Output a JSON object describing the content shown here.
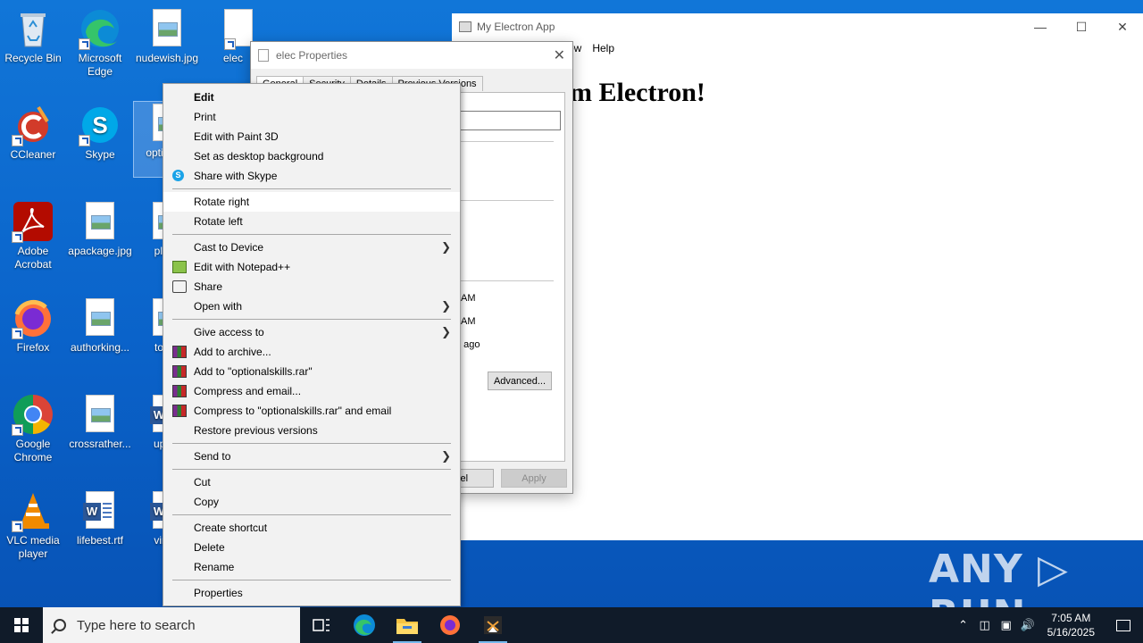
{
  "desktop": {
    "icons": [
      {
        "label": "Recycle Bin"
      },
      {
        "label": "Microsoft Edge"
      },
      {
        "label": "nudewish.jpg"
      },
      {
        "label": "elec"
      },
      {
        "label": "CCleaner"
      },
      {
        "label": "Skype"
      },
      {
        "label": "optio… .j"
      },
      {
        "label": "Adobe Acrobat"
      },
      {
        "label": "apackage.jpg"
      },
      {
        "label": "plans"
      },
      {
        "label": "Firefox"
      },
      {
        "label": "authorking..."
      },
      {
        "label": "toolki"
      },
      {
        "label": "Google Chrome"
      },
      {
        "label": "crossrather..."
      },
      {
        "label": "updat"
      },
      {
        "label": "VLC media player"
      },
      {
        "label": "lifebest.rtf"
      },
      {
        "label": "virtua"
      }
    ]
  },
  "electron": {
    "title": "My Electron App",
    "menu": [
      "ow",
      "Help"
    ],
    "heading": "m Electron!",
    "minimize": "—",
    "maximize": "☐",
    "close": "✕"
  },
  "properties": {
    "title": "elec Properties",
    "close": "✕",
    "tabs": [
      "General",
      "Security",
      "Details",
      "Previous Versions"
    ],
    "times": [
      "AM",
      "AM",
      "e ago"
    ],
    "advanced": "Advanced...",
    "cancel": "ncel",
    "apply": "Apply"
  },
  "context_menu": {
    "items": [
      {
        "label": "Edit",
        "bold": true
      },
      {
        "label": "Print"
      },
      {
        "label": "Edit with Paint 3D"
      },
      {
        "label": "Set as desktop background"
      },
      {
        "label": "Share with Skype",
        "icon": "skype-icon"
      },
      {
        "label": "Rotate right"
      },
      {
        "label": "Rotate left"
      },
      {
        "label": "Cast to Device",
        "submenu": true
      },
      {
        "label": "Edit with Notepad++",
        "icon": "notepadpp-icon"
      },
      {
        "label": "Share",
        "icon": "share-icon"
      },
      {
        "label": "Open with",
        "submenu": true
      },
      {
        "label": "Give access to",
        "submenu": true
      },
      {
        "label": "Add to archive...",
        "icon": "winrar-icon"
      },
      {
        "label": "Add to \"optionalskills.rar\"",
        "icon": "winrar-icon"
      },
      {
        "label": "Compress and email...",
        "icon": "winrar-icon"
      },
      {
        "label": "Compress to \"optionalskills.rar\" and email",
        "icon": "winrar-icon"
      },
      {
        "label": "Restore previous versions"
      },
      {
        "label": "Send to",
        "submenu": true
      },
      {
        "label": "Cut"
      },
      {
        "label": "Copy"
      },
      {
        "label": "Create shortcut"
      },
      {
        "label": "Delete"
      },
      {
        "label": "Rename"
      },
      {
        "label": "Properties"
      }
    ],
    "submenu_arrow": "❯"
  },
  "watermark": "ANY ▷ RUN",
  "taskbar": {
    "search_placeholder": "Type here to search",
    "time": "7:05 AM",
    "date": "5/16/2025",
    "tray_chevron": "⌃"
  }
}
